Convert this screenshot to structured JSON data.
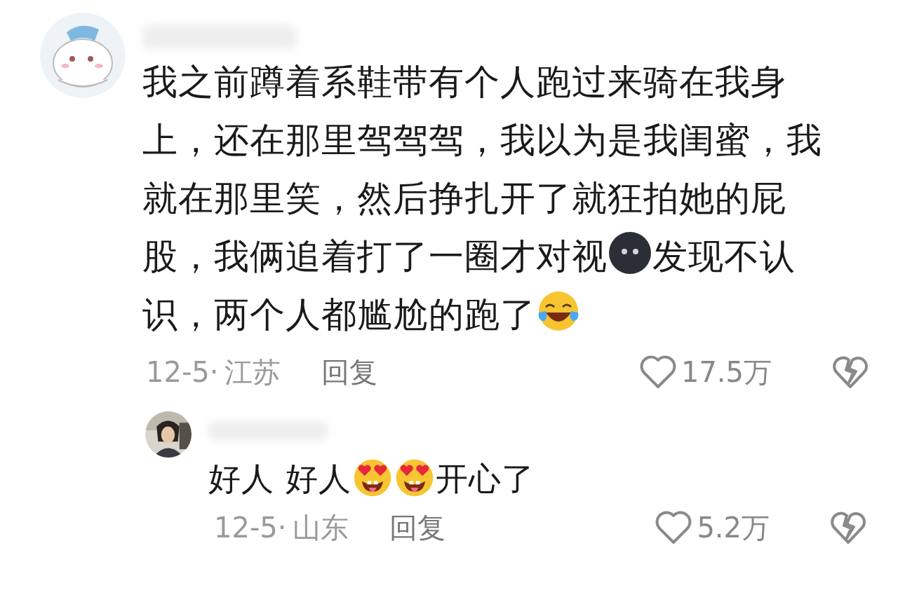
{
  "comments": [
    {
      "avatar": {
        "kind": "picture"
      },
      "lines": [
        [
          {
            "kind": "text",
            "text": "我之前蹲着系鞋带有个人跑过来骑在我身"
          }
        ],
        [
          {
            "kind": "text",
            "text": "上，还在那里驾驾驾，我以为是我闺蜜，我"
          }
        ],
        [
          {
            "kind": "text",
            "text": "就在那里笑，然后挣扎开了就狂拍她的屁"
          }
        ],
        [
          {
            "kind": "text",
            "text": "股，我俩追着打了一圈才对视"
          },
          {
            "kind": "emoji-dark"
          },
          {
            "kind": "text",
            "text": "发现不认"
          }
        ],
        [
          {
            "kind": "text",
            "text": "识，两个人都尴尬的跑了"
          },
          {
            "kind": "emoji-laugh"
          }
        ]
      ],
      "date": "12-5·",
      "location": "江苏",
      "reply": "回复",
      "likes": "17.5万",
      "liked": false,
      "disliked": false,
      "reply_level": false
    },
    {
      "avatar": {
        "kind": "picture"
      },
      "lines": [
        [
          {
            "kind": "text",
            "text": "好人 好人"
          },
          {
            "kind": "emoji-hearteyes"
          },
          {
            "kind": "emoji-hearteyes"
          },
          {
            "kind": "text",
            "text": "开心了"
          }
        ]
      ],
      "date": "12-5·",
      "location": "山东",
      "reply": "回复",
      "likes": "5.2万",
      "liked": false,
      "disliked": false,
      "reply_level": true
    }
  ]
}
